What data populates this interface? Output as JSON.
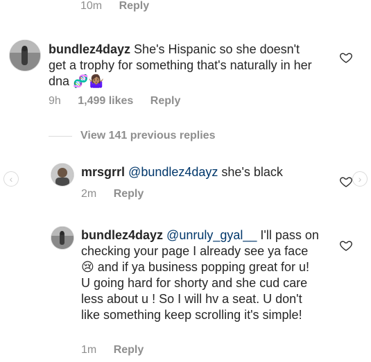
{
  "top_meta": {
    "time": "10m",
    "reply": "Reply"
  },
  "comment1": {
    "username": "bundlez4dayz",
    "text": "She's Hispanic so she doesn't get a trophy for something that's naturally in her dna",
    "emoji": "🧬🤷🏽‍♀️",
    "time": "9h",
    "likes": "1,499 likes",
    "reply": "Reply"
  },
  "view_replies": "View 141 previous replies",
  "reply1": {
    "username": "mrsgrrl",
    "mention": "@bundlez4dayz",
    "text": "she's black",
    "time": "2m",
    "reply": "Reply"
  },
  "reply2": {
    "username": "bundlez4dayz",
    "mention": "@unruly_gyal__",
    "text_a": "I'll pass on checking your page I already see ya face",
    "emoji": "😢",
    "text_b": "and if ya business popping great for u! U going hard for shorty and she cud care less about u ! So I will hv a seat. U don't like something keep scrolling it's simple!",
    "time": "1m",
    "reply": "Reply"
  },
  "icons": {
    "like": "heart-icon",
    "prev": "chevron-left-icon",
    "next": "chevron-right-icon"
  },
  "colors": {
    "text": "#262626",
    "muted": "#8e8e8e",
    "mention": "#00376b",
    "divider": "#dbdbdb"
  }
}
